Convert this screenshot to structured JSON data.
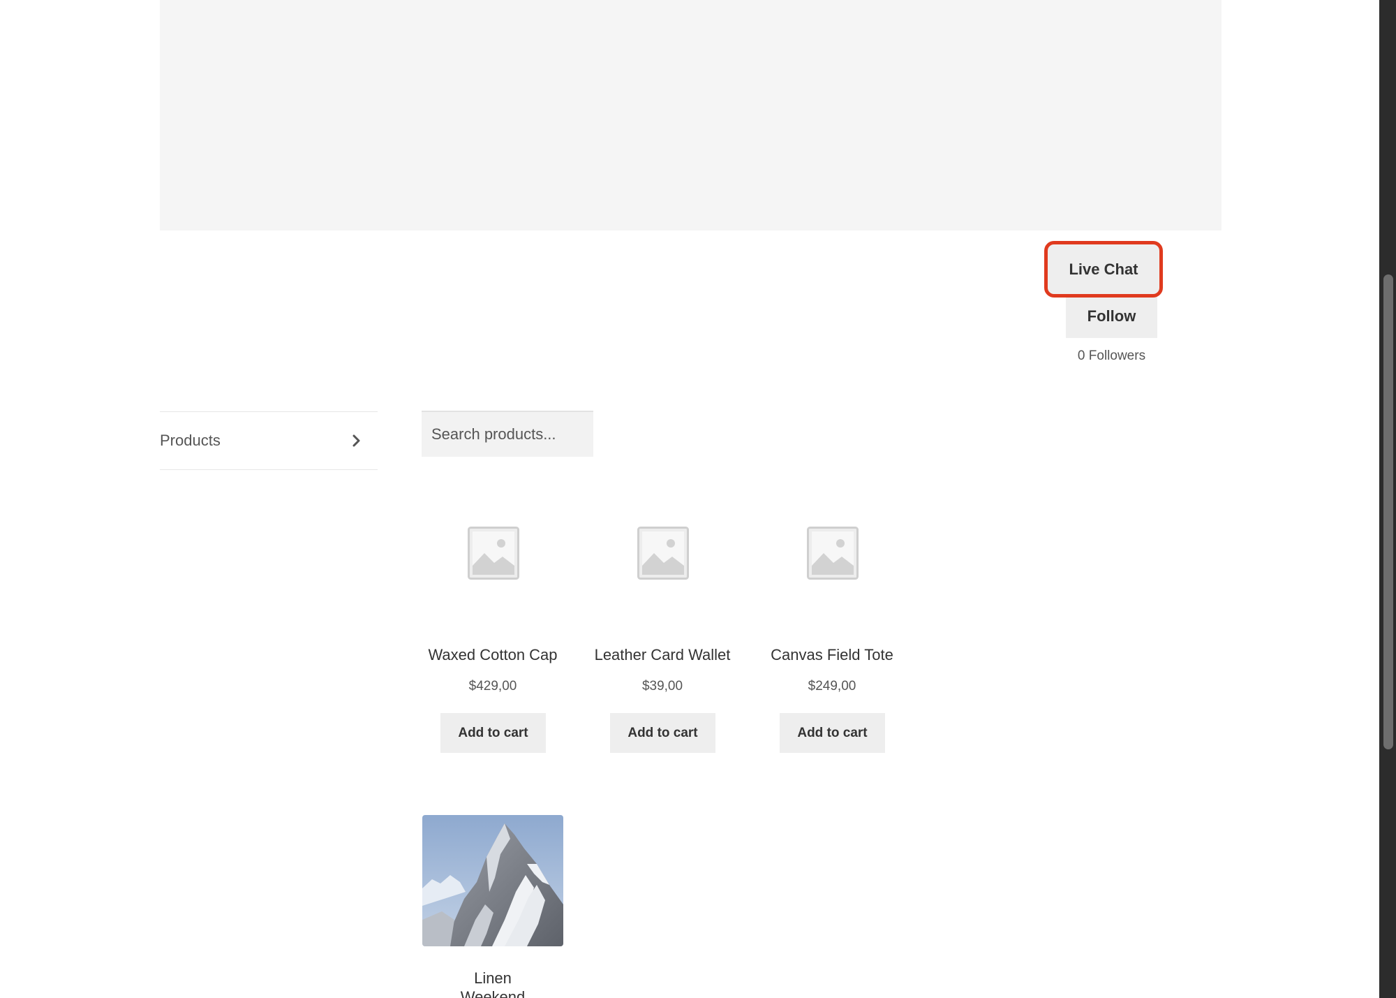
{
  "store": {
    "live_chat_label": "Live Chat",
    "follow_label": "Follow",
    "followers_text": "0 Followers"
  },
  "sidebar": {
    "products_label": "Products"
  },
  "search": {
    "placeholder": "Search products..."
  },
  "products": [
    {
      "title": "Waxed Cotton Cap",
      "price": "$429,00",
      "button": "Add to cart",
      "image": "placeholder-image-icon"
    },
    {
      "title": "Leather Card Wallet",
      "price": "$39,00",
      "button": "Add to cart",
      "image": "placeholder-image-icon"
    },
    {
      "title": "Canvas Field Tote",
      "price": "$249,00",
      "button": "Add to cart",
      "image": "placeholder-image-icon"
    },
    {
      "title": "Linen Weekend Duffel",
      "image": "snowy-mountain-photo"
    }
  ],
  "colors": {
    "highlight_border": "#e03a1e",
    "button_bg": "#eeeeee",
    "banner_bg": "#f5f5f5"
  }
}
